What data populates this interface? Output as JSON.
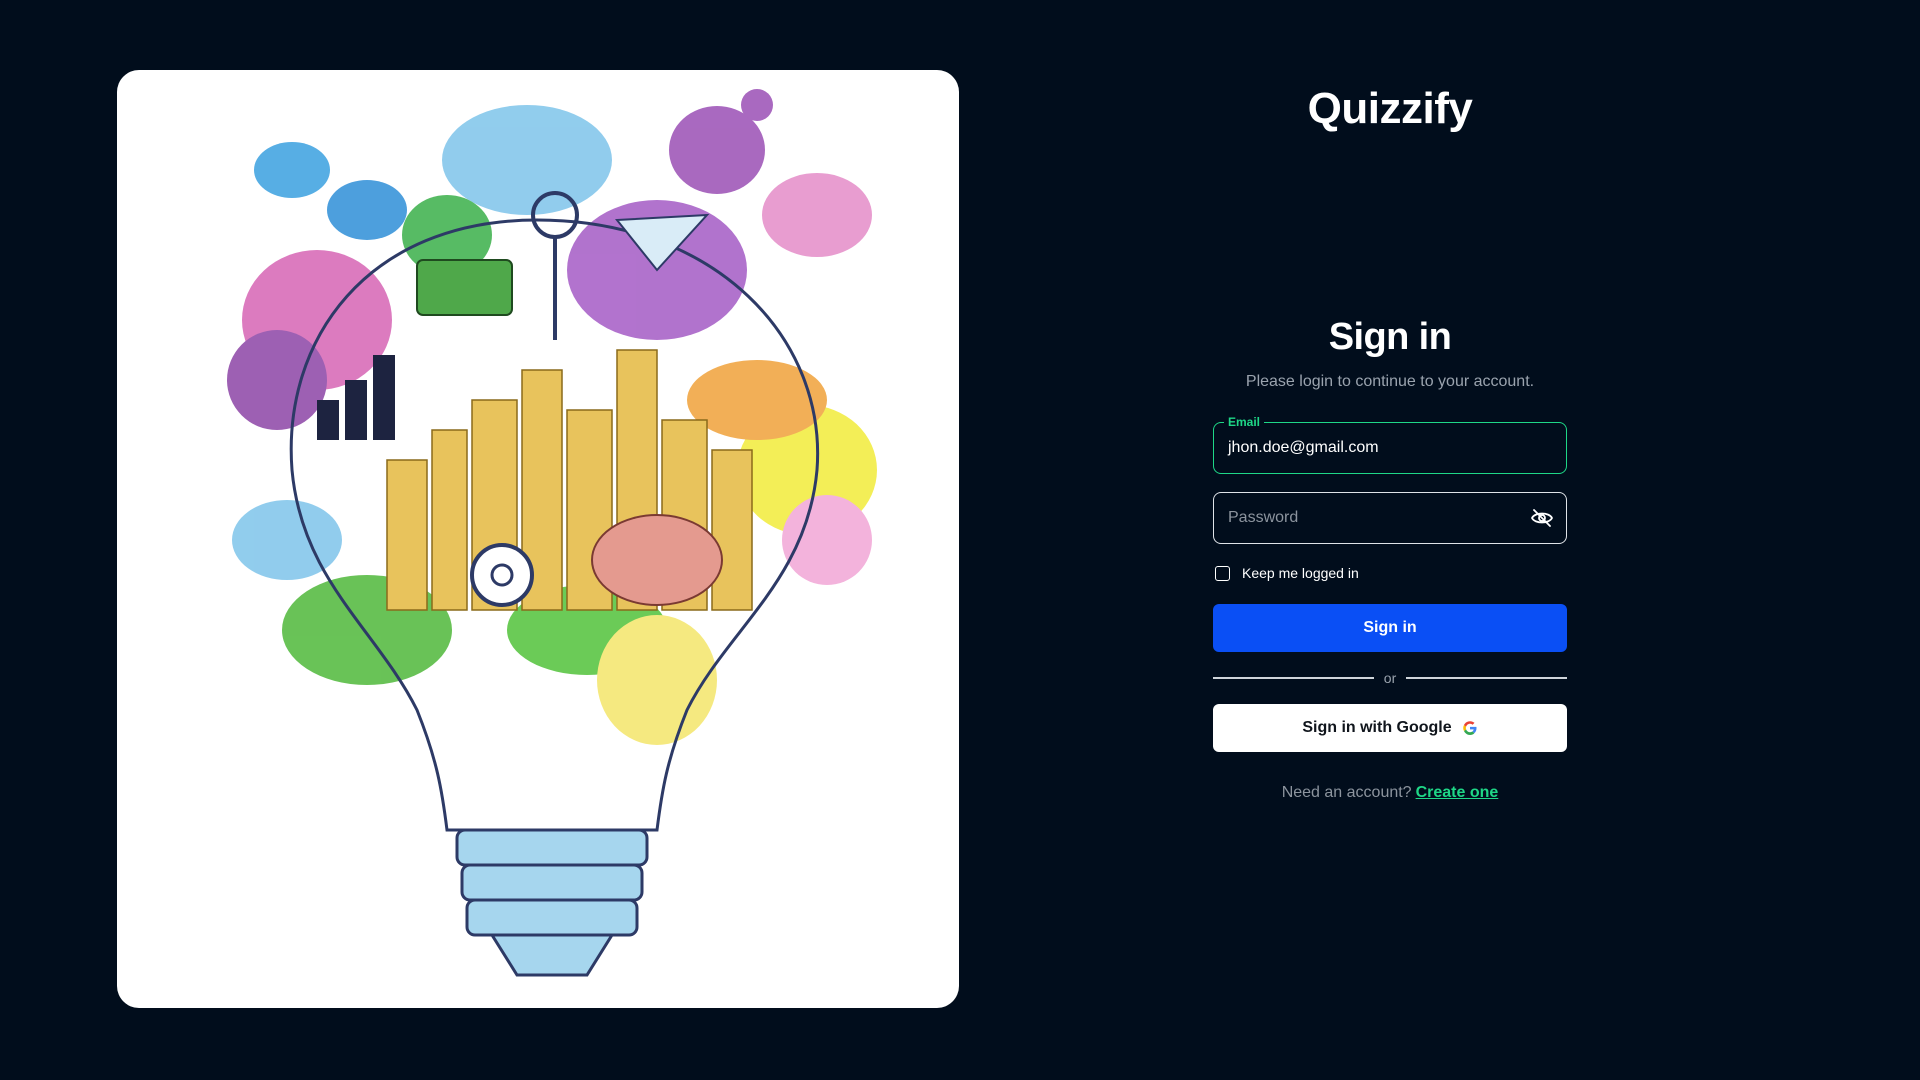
{
  "brand": {
    "name": "Quizzify"
  },
  "hero": {
    "image": "lightbulb-ideas-illustration"
  },
  "signin": {
    "heading": "Sign in",
    "subheading": "Please login to continue to your account.",
    "email": {
      "label": "Email",
      "value": "jhon.doe@gmail.com"
    },
    "password": {
      "placeholder": "Password",
      "visibility_icon": "eye-off-icon"
    },
    "remember_label": "Keep me logged in",
    "submit_label": "Sign in",
    "divider_text": "or",
    "google_label": "Sign in with Google",
    "google_icon": "google-icon",
    "signup_prompt": "Need an account?",
    "signup_link": "Create one"
  },
  "colors": {
    "background": "#010d1c",
    "accent_green": "#1ed787",
    "primary_blue": "#0a4ff5",
    "muted_text": "#8c949e"
  }
}
